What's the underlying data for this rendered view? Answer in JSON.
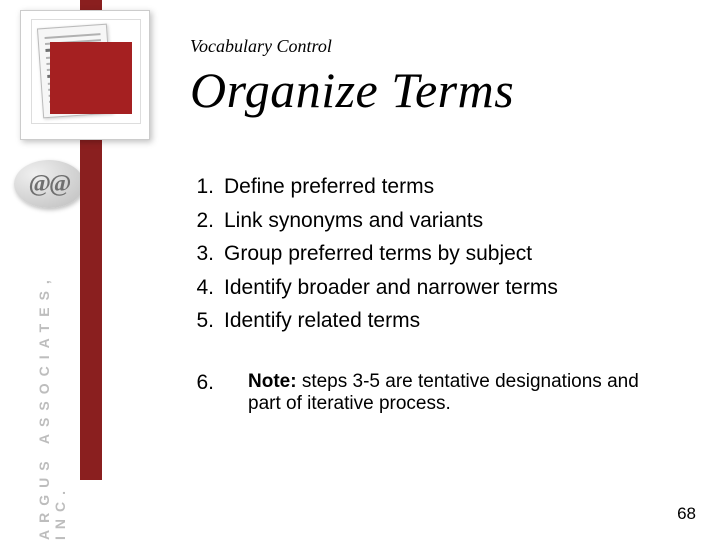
{
  "sidebar": {
    "badge": "@@",
    "company": "ARGUS ASSOCIATES, INC."
  },
  "header": {
    "kicker": "Vocabulary Control",
    "title": "Organize Terms"
  },
  "steps": [
    {
      "num": "1.",
      "text": "Define preferred terms"
    },
    {
      "num": "2.",
      "text": "Link synonyms and variants"
    },
    {
      "num": "3.",
      "text": "Group preferred terms by subject"
    },
    {
      "num": "4.",
      "text": "Identify broader and narrower terms"
    },
    {
      "num": "5.",
      "text": "Identify related terms"
    }
  ],
  "note": {
    "num": "6.",
    "label": "Note:",
    "text": " steps 3-5 are tentative designations and part of iterative process."
  },
  "page_number": "68"
}
